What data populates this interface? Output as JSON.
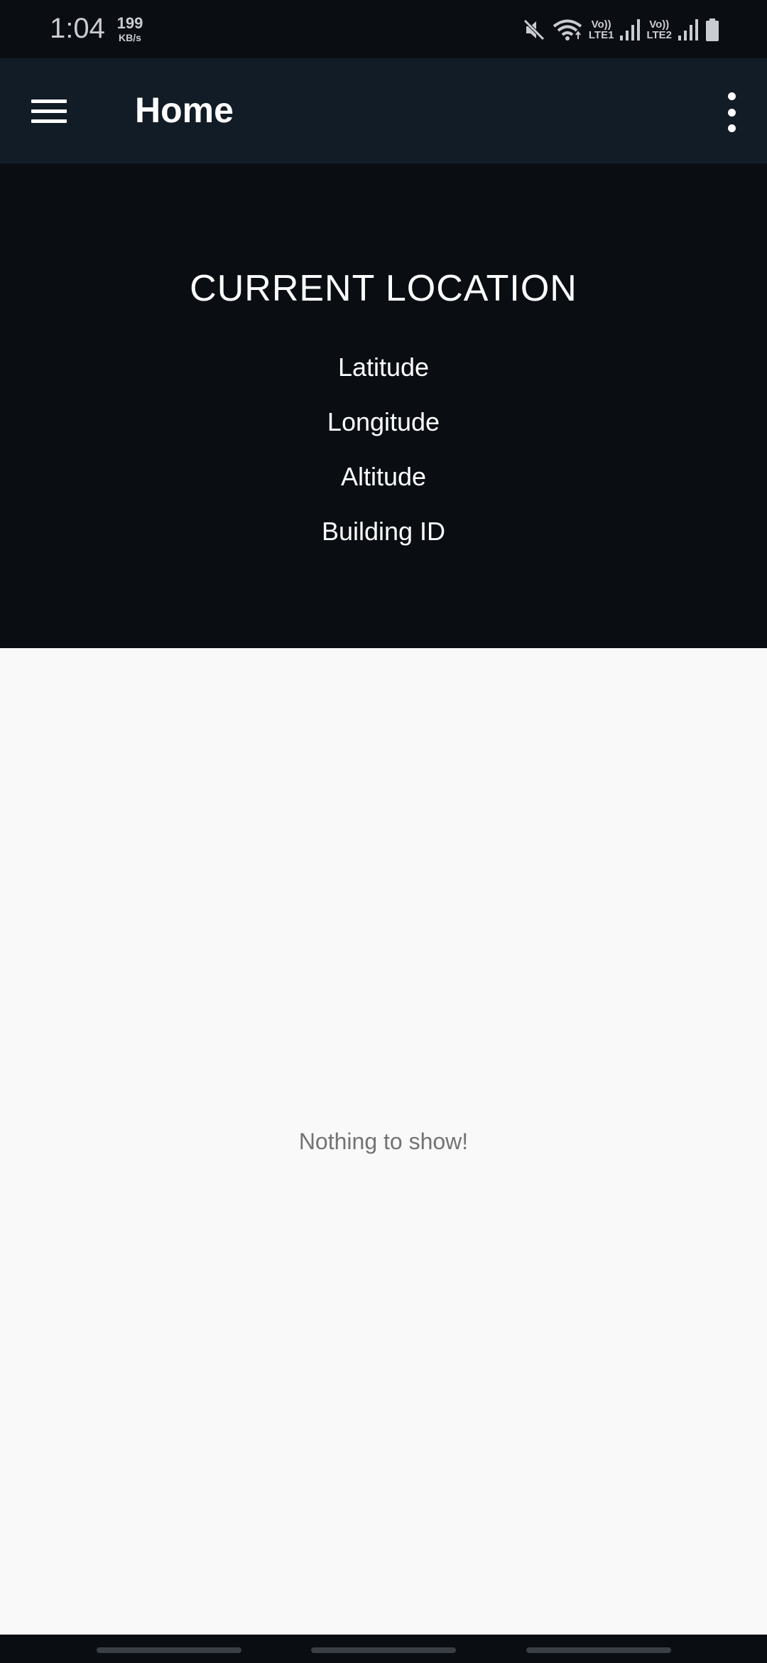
{
  "status_bar": {
    "time": "1:04",
    "net_speed_value": "199",
    "net_speed_unit": "KB/s",
    "sim1_top": "Vo))",
    "sim1_bottom": "LTE1",
    "sim2_top": "Vo))",
    "sim2_bottom": "LTE2",
    "icons": [
      "mute-icon",
      "wifi-icon",
      "signal-icon",
      "signal-icon",
      "battery-icon"
    ]
  },
  "app_bar": {
    "title": "Home",
    "menu_icon": "hamburger-menu-icon",
    "overflow_icon": "more-vertical-icon"
  },
  "location": {
    "heading": "CURRENT LOCATION",
    "fields": [
      "Latitude",
      "Longitude",
      "Altitude",
      "Building ID"
    ]
  },
  "content": {
    "empty_message": "Nothing to show!"
  },
  "colors": {
    "background_dark": "#0a0e13",
    "app_bar": "#121c26",
    "content_background": "#f9f9f9",
    "empty_text": "#737373"
  }
}
